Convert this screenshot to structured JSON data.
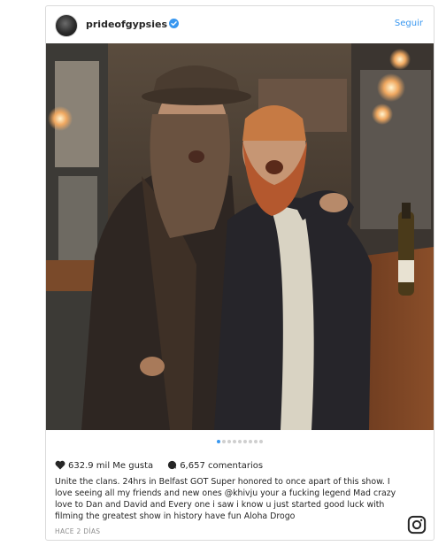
{
  "post": {
    "username": "prideofgypsies",
    "follow_label": "Seguir",
    "likes_text": "632.9 mil Me gusta",
    "comments_text": "6,657 comentarios",
    "caption_lines": [
      "Unite the clans. 24hrs in Belfast GOT Super honored to once apart of this show. I",
      "love seeing all my friends and new ones @khivju your a fucking legend Mad crazy",
      "love to Dan and David and Every one i saw i know u just started good luck with",
      "filming the greatest show in history have fun Aloha Drogo"
    ],
    "timestamp": "HACE 2 DÍAS",
    "carousel": {
      "total": 9,
      "active_index": 0
    },
    "icons": {
      "verified": "verified-badge-icon",
      "like": "heart-icon",
      "comment": "comment-bubble-icon",
      "brand": "instagram-logo-icon"
    },
    "colors": {
      "link_blue": "#3897f0",
      "text": "#262626",
      "muted": "#8e8e8e",
      "border": "#dbdbdb"
    }
  }
}
